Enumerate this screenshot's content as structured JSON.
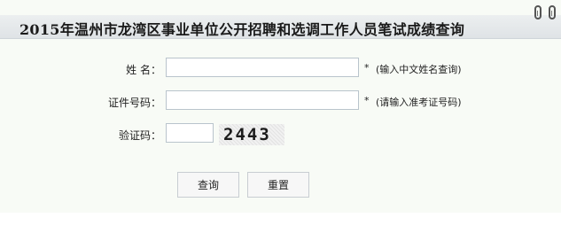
{
  "header": {
    "title": "2015年温州市龙湾区事业单位公开招聘和选调工作人员笔试成绩查询"
  },
  "form": {
    "name_label": "姓  名：",
    "name_value": "",
    "name_required": "*",
    "name_hint": "(输入中文姓名查询)",
    "id_label": "证件号码：",
    "id_value": "",
    "id_required": "*",
    "id_hint": "(请输入准考证号码)",
    "code_label": "验证码：",
    "code_value": "",
    "captcha_text": "2443"
  },
  "buttons": {
    "query_label": "查询",
    "reset_label": "重置"
  }
}
